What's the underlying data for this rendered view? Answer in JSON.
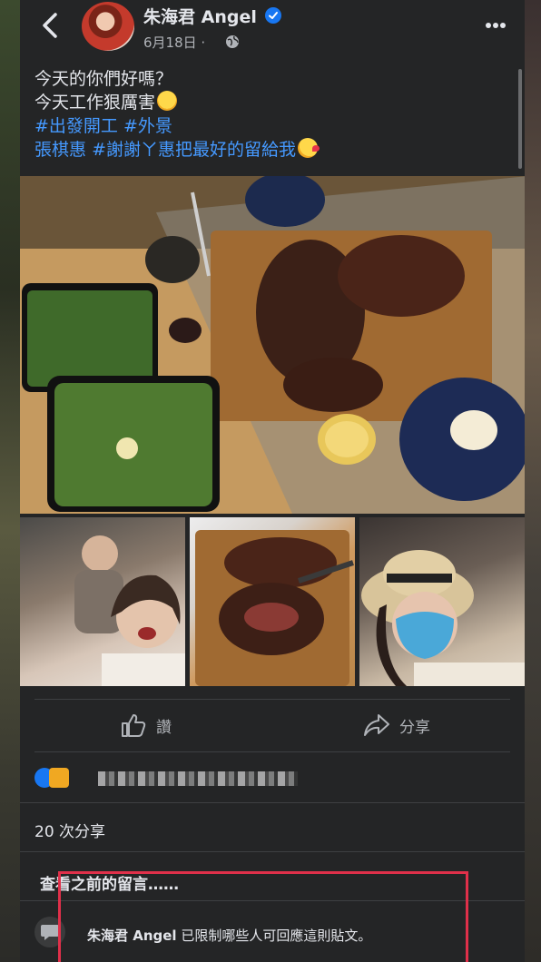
{
  "header": {
    "author": "朱海君 Angel",
    "date": "6月18日 ·",
    "icons": [
      "back-icon",
      "verified-icon",
      "globe-icon",
      "more-icon"
    ]
  },
  "post": {
    "line1": "今天的你們好嗎？",
    "line2": "今天工作狠厲害",
    "tag1": "#出發開工",
    "tag2": "#外景",
    "mention": "張棋惠",
    "tag3": "#謝謝ㄚ惠把最好的留給我"
  },
  "actions": {
    "like_label": "讚",
    "share_label": "分享"
  },
  "stats": {
    "shares": "20 次分享"
  },
  "comments": {
    "previous": "查看之前的留言……",
    "restrict_name": "朱海君 Angel",
    "restrict_text": " 已限制哪些人可回應這則貼文。"
  },
  "colors": {
    "background": "#242526",
    "text": "#e4e6eb",
    "secondary": "#b0b3b8",
    "link": "#4599ff",
    "verified": "#1877f2",
    "highlight": "#e0304a"
  }
}
